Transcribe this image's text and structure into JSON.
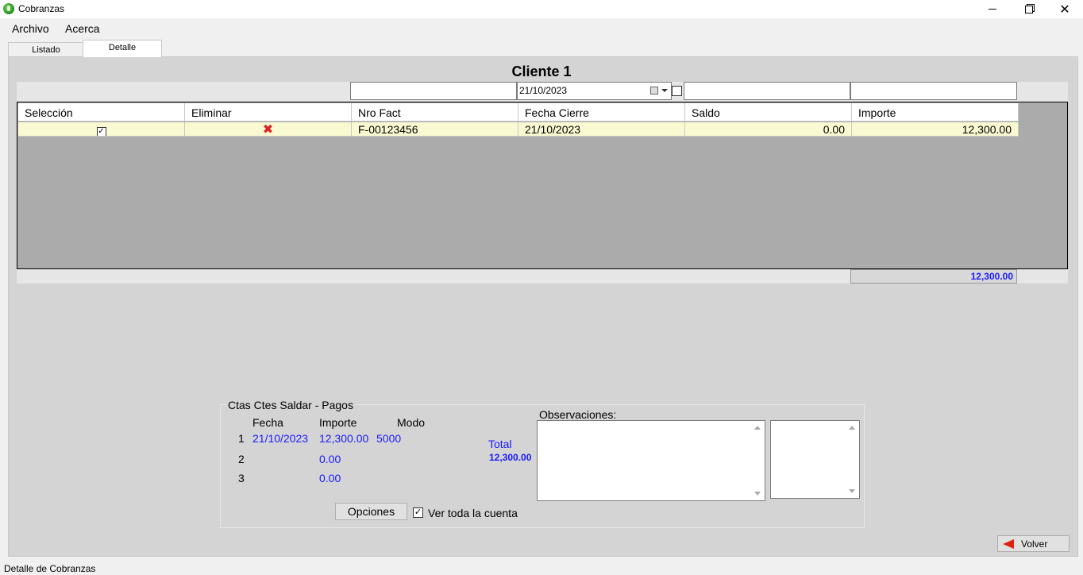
{
  "window": {
    "title": "Cobranzas",
    "close_glyph": "✕"
  },
  "menu": {
    "items": [
      {
        "label": "Archivo"
      },
      {
        "label": "Acerca"
      }
    ]
  },
  "tabs": [
    {
      "label": "Listado"
    },
    {
      "label": "Detalle",
      "active": true
    }
  ],
  "client": {
    "title": "Cliente 1"
  },
  "filters": {
    "date": "21/10/2023"
  },
  "grid": {
    "columns": [
      "Selección",
      "Eliminar",
      "Nro Fact",
      "Fecha Cierre",
      "Saldo",
      "Importe"
    ],
    "rows": [
      {
        "selected": true,
        "nro_fact": "F-00123456",
        "fecha_cierre": "21/10/2023",
        "saldo": "0.00",
        "importe": "12,300.00"
      }
    ],
    "total": "12,300.00"
  },
  "payments": {
    "group_title": "Ctas Ctes Saldar - Pagos",
    "headers": {
      "fecha": "Fecha",
      "importe": "Importe",
      "modo": "Modo"
    },
    "rows": [
      {
        "n": "1",
        "fecha": "21/10/2023",
        "importe": "12,300.00",
        "modo": "5000"
      },
      {
        "n": "2",
        "fecha": "",
        "importe": "0.00",
        "modo": ""
      },
      {
        "n": "3",
        "fecha": "",
        "importe": "0.00",
        "modo": ""
      }
    ],
    "total_label": "Total",
    "total_value": "12,300.00",
    "options_button": "Opciones",
    "ver_toda_label": "Ver toda la cuenta",
    "ver_toda_checked": true
  },
  "observaciones": {
    "label": "Observaciones:"
  },
  "volver_button": "Volver",
  "status": {
    "text": "Detalle de Cobranzas"
  },
  "colors": {
    "accent_blue": "#1a1aff",
    "row_highlight": "#fafad2",
    "delete_red": "#d22222"
  },
  "icons": {
    "app": "globe-icon",
    "delete": "red-x-icon",
    "back": "red-arrow-left-icon"
  }
}
